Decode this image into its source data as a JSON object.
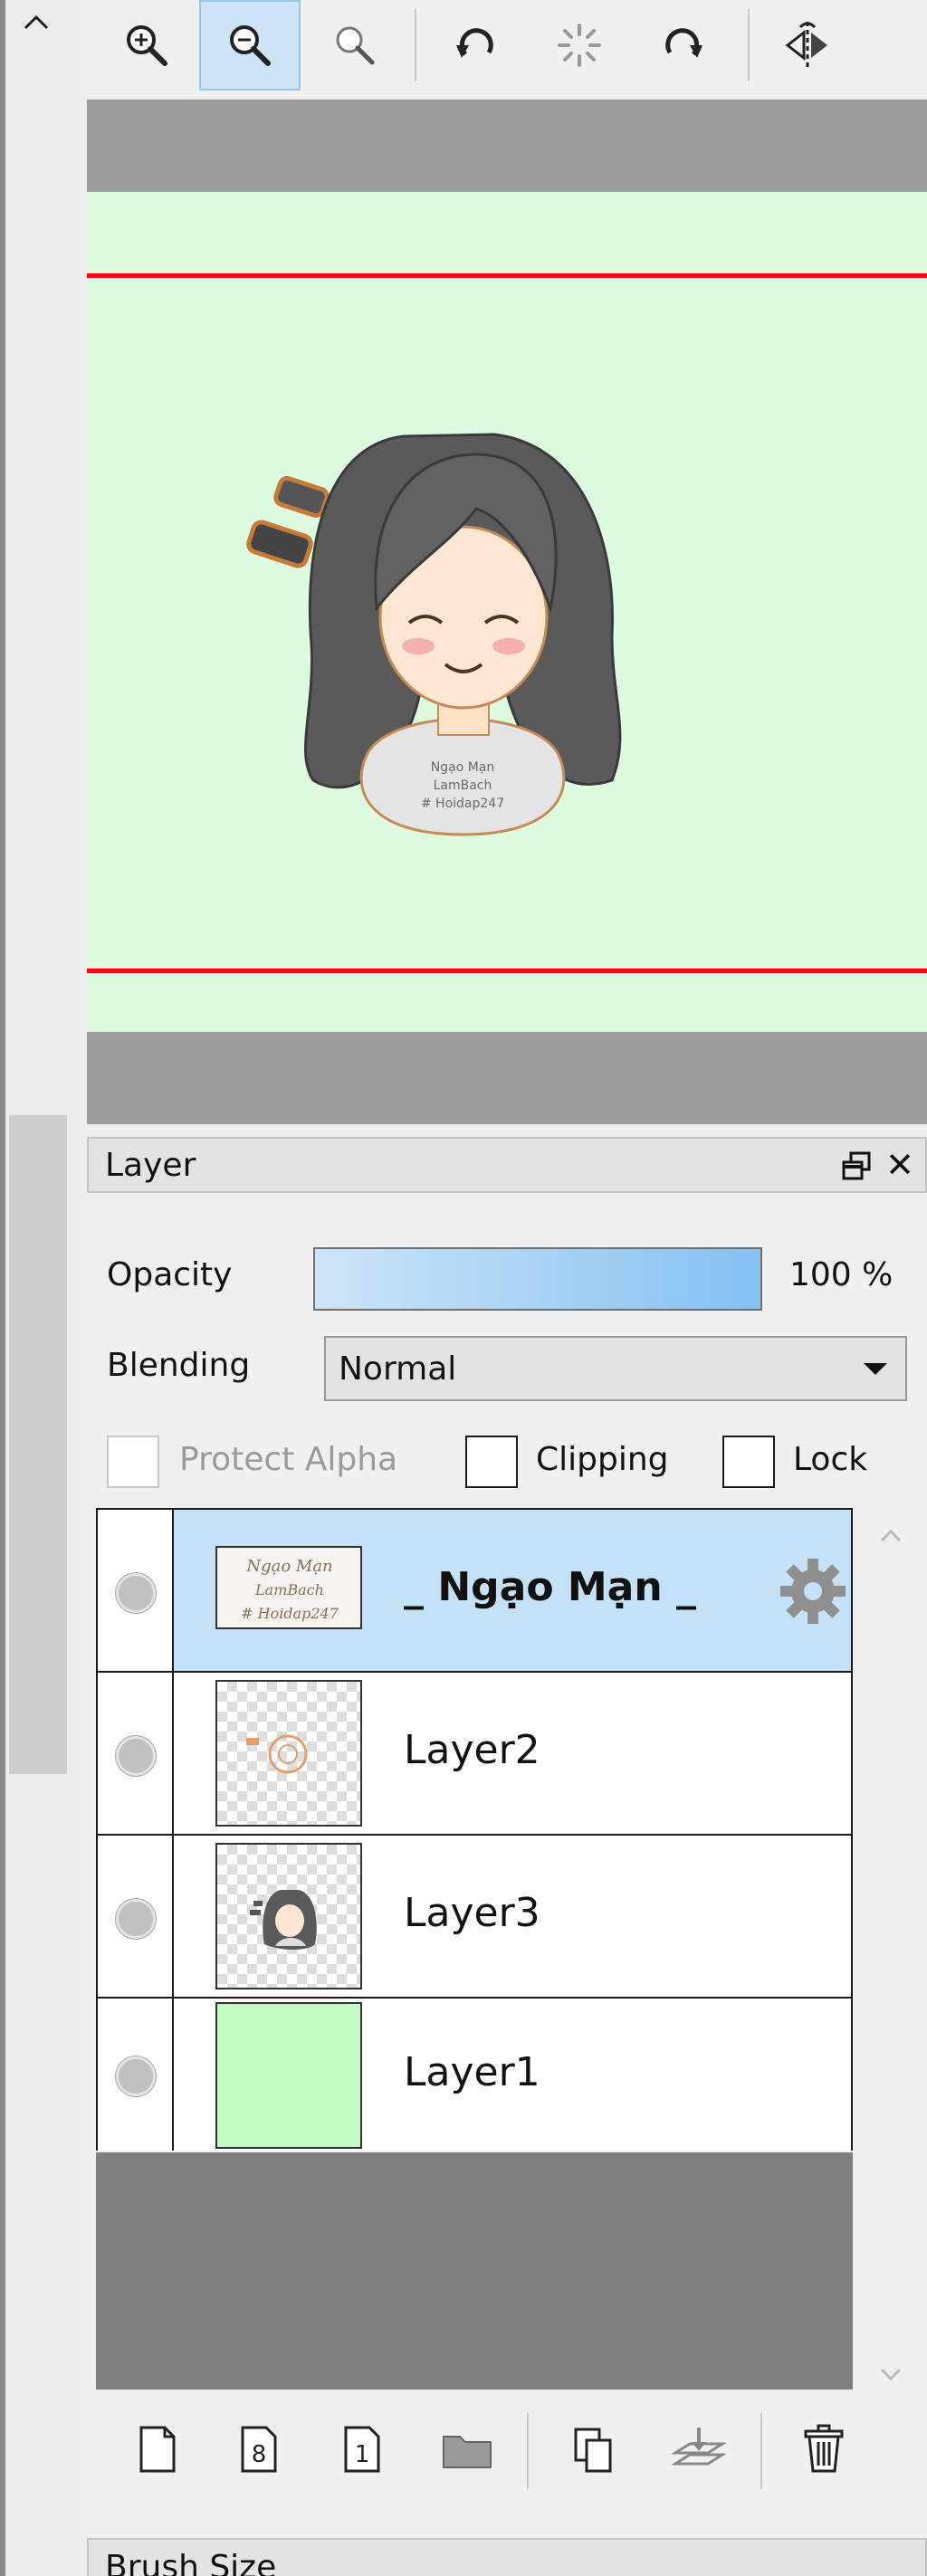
{
  "toolbar": {
    "buttons": [
      "zoom-in",
      "zoom-out",
      "zoom-reset",
      "rotate-left",
      "rotate-reset",
      "rotate-right",
      "flip-horizontal"
    ],
    "active": "zoom-out"
  },
  "canvas": {
    "background_color": "#ddfcdf",
    "guide_color": "#ee1111",
    "artwork_text": [
      "Ngạo Mạn",
      "LamBach",
      "# Hoidap247"
    ]
  },
  "layer_panel": {
    "title": "Layer",
    "opacity_label": "Opacity",
    "opacity_value": "100 %",
    "opacity_fraction": 1.0,
    "blending_label": "Blending",
    "blending_value": "Normal",
    "protect_alpha_label": "Protect Alpha",
    "clipping_label": "Clipping",
    "lock_label": "Lock",
    "layers": [
      {
        "name": "_ Ngạo Mạn _",
        "selected": true
      },
      {
        "name": "Layer2",
        "selected": false
      },
      {
        "name": "Layer3",
        "selected": false
      },
      {
        "name": "Layer1",
        "selected": false
      }
    ]
  },
  "next_panel": {
    "title": "Brush Size"
  },
  "colors": {
    "selection": "#c4e1f7",
    "layer1_fill": "#c2fbc4",
    "opacity_bar_start": "#cde4f6",
    "opacity_bar_end": "#85c1f2"
  }
}
